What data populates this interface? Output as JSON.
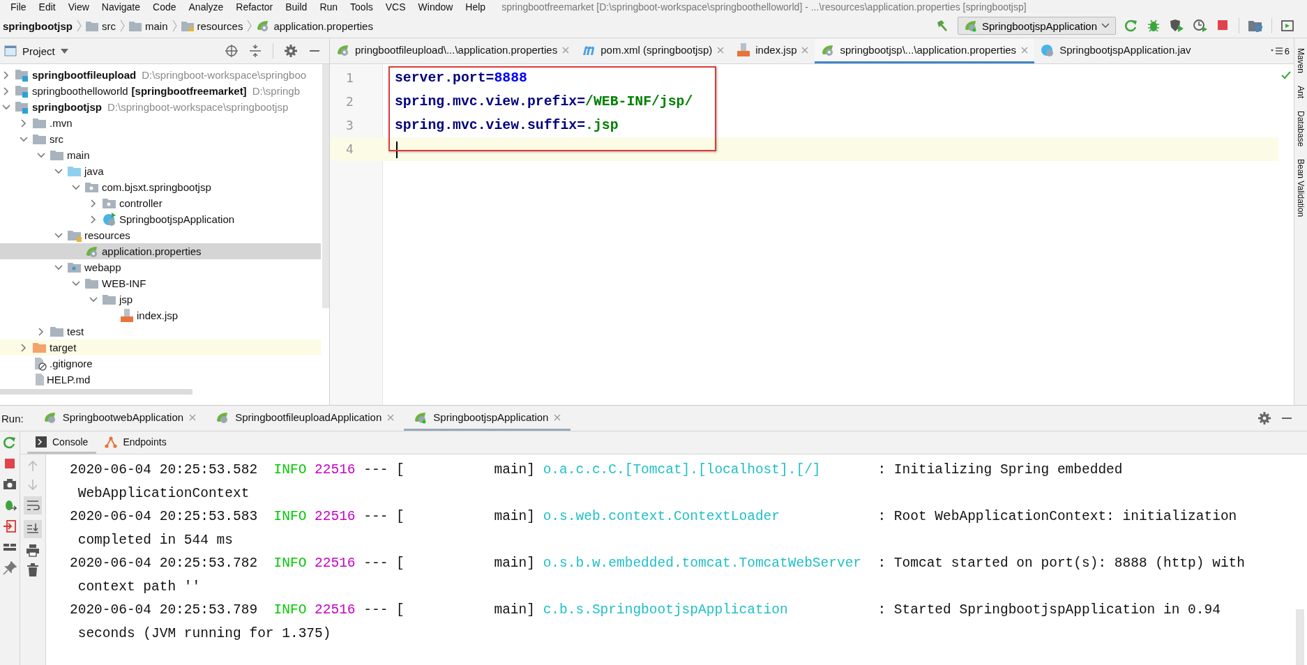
{
  "menu": [
    "File",
    "Edit",
    "View",
    "Navigate",
    "Code",
    "Analyze",
    "Refactor",
    "Build",
    "Run",
    "Tools",
    "VCS",
    "Window",
    "Help"
  ],
  "window": {
    "title": "springbootfreemarket [D:\\springboot-workspace\\springboothelloworld] - ...\\resources\\application.properties [springbootjsp]"
  },
  "breadcrumb": [
    {
      "kind": "module",
      "label": "springbootjsp"
    },
    {
      "kind": "folder",
      "label": "src"
    },
    {
      "kind": "folder",
      "label": "main"
    },
    {
      "kind": "resources-folder",
      "label": "resources"
    },
    {
      "kind": "properties",
      "label": "application.properties"
    }
  ],
  "run_config": {
    "label": "SpringbootjspApplication"
  },
  "project": {
    "title": "Project",
    "tree": [
      {
        "kind": "module",
        "label": "springbootfileupload",
        "bold": true,
        "path": "D:\\springboot-workspace\\springboo",
        "expanded": false,
        "selected": false
      },
      {
        "kind": "module",
        "label": "springboothelloworld",
        "tag": "[springbootfreemarket]",
        "path": "D:\\springb",
        "expanded": false,
        "selected": false
      },
      {
        "kind": "module",
        "label": "springbootjsp",
        "bold": true,
        "path": "D:\\springboot-workspace\\springbootjsp",
        "expanded": true,
        "selected": false,
        "children": [
          {
            "kind": "folder",
            "label": ".mvn",
            "expanded": false,
            "selected": false
          },
          {
            "kind": "folder",
            "label": "src",
            "expanded": true,
            "selected": false,
            "children": [
              {
                "kind": "folder",
                "label": "main",
                "expanded": true,
                "selected": false,
                "children": [
                  {
                    "kind": "source-folder",
                    "label": "java",
                    "expanded": true,
                    "selected": false,
                    "children": [
                      {
                        "kind": "package",
                        "label": "com.bjsxt.springbootjsp",
                        "expanded": true,
                        "selected": false,
                        "children": [
                          {
                            "kind": "package",
                            "label": "controller",
                            "expanded": false,
                            "selected": false
                          },
                          {
                            "kind": "class",
                            "label": "SpringbootjspApplication",
                            "expanded": false,
                            "selected": false
                          }
                        ]
                      }
                    ]
                  },
                  {
                    "kind": "resources-folder",
                    "label": "resources",
                    "expanded": true,
                    "selected": false,
                    "children": [
                      {
                        "kind": "properties",
                        "label": "application.properties",
                        "selected": true
                      }
                    ]
                  },
                  {
                    "kind": "web-folder",
                    "label": "webapp",
                    "expanded": true,
                    "selected": false,
                    "children": [
                      {
                        "kind": "folder",
                        "label": "WEB-INF",
                        "expanded": true,
                        "selected": false,
                        "children": [
                          {
                            "kind": "folder",
                            "label": "jsp",
                            "expanded": true,
                            "selected": false,
                            "children": [
                              {
                                "kind": "jsp",
                                "label": "index.jsp",
                                "selected": false
                              }
                            ]
                          }
                        ]
                      }
                    ]
                  }
                ]
              },
              {
                "kind": "folder",
                "label": "test",
                "expanded": false,
                "selected": false
              }
            ]
          },
          {
            "kind": "excluded-folder",
            "label": "target",
            "expanded": false,
            "selected": false
          },
          {
            "kind": "ignore-file",
            "label": ".gitignore",
            "selected": false
          },
          {
            "kind": "markdown-file",
            "label": "HELP.md",
            "selected": false
          }
        ]
      }
    ]
  },
  "editor_tabs": [
    {
      "kind": "properties",
      "label": "pringbootfileupload\\...\\application.properties",
      "selected": false
    },
    {
      "kind": "maven",
      "label": "pom.xml (springbootjsp)",
      "selected": false
    },
    {
      "kind": "jsp",
      "label": "index.jsp",
      "selected": false
    },
    {
      "kind": "properties",
      "label": "springbootjsp\\...\\application.properties",
      "selected": true
    },
    {
      "kind": "class",
      "label": "SpringbootjspApplication.jav",
      "selected": false
    }
  ],
  "hidden_tabs_count": "6",
  "editor": {
    "annotation_box": true,
    "lines": [
      {
        "number": "1",
        "key": "server.port=",
        "value": "8888",
        "kind": "number",
        "current": false
      },
      {
        "number": "2",
        "key": "spring.mvc.view.prefix=",
        "value": "/WEB-INF/jsp/",
        "kind": "string",
        "current": false
      },
      {
        "number": "3",
        "key": "spring.mvc.view.suffix=",
        "value": ".jsp",
        "kind": "string",
        "current": false
      },
      {
        "number": "4",
        "current": true
      }
    ]
  },
  "side_tools": [
    "Maven",
    "Ant",
    "Database",
    "Bean Validation"
  ],
  "run": {
    "label": "Run:",
    "tabs": [
      {
        "label": "SpringbootwebApplication",
        "selected": false
      },
      {
        "label": "SpringbootfileuploadApplication",
        "selected": false
      },
      {
        "label": "SpringbootjspApplication",
        "selected": true
      }
    ],
    "console_tabs": [
      {
        "kind": "console",
        "label": "Console",
        "selected": true
      },
      {
        "kind": "endpoints",
        "label": "Endpoints",
        "selected": false
      }
    ],
    "log": [
      {
        "timestamp": "2020-06-04 20:25:53.582",
        "level": "INFO",
        "pid": "22516",
        "separator": "---",
        "thread": "[           main]",
        "logger": "o.a.c.c.C.[Tomcat].[localhost].[/]",
        "message": ": Initializing Spring embedded",
        "continuation": "WebApplicationContext"
      },
      {
        "timestamp": "2020-06-04 20:25:53.583",
        "level": "INFO",
        "pid": "22516",
        "separator": "---",
        "thread": "[           main]",
        "logger": "o.s.web.context.ContextLoader",
        "message": ": Root WebApplicationContext: initialization",
        "continuation": "completed in 544 ms"
      },
      {
        "timestamp": "2020-06-04 20:25:53.782",
        "level": "INFO",
        "pid": "22516",
        "separator": "---",
        "thread": "[           main]",
        "logger": "o.s.b.w.embedded.tomcat.TomcatWebServer",
        "message": ": Tomcat started on port(s): 8888 (http) with",
        "continuation": "context path ''"
      },
      {
        "timestamp": "2020-06-04 20:25:53.789",
        "level": "INFO",
        "pid": "22516",
        "separator": "---",
        "thread": "[           main]",
        "logger": "c.b.s.SpringbootjspApplication",
        "message": ": Started SpringbootjspApplication in 0.94",
        "continuation": "seconds (JVM running for 1.375)"
      }
    ]
  }
}
